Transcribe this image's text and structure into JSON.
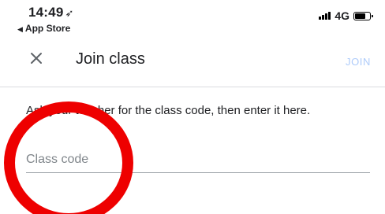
{
  "status_bar": {
    "time": "14:49",
    "location_icon": "location-arrow-icon",
    "back_app": "App Store",
    "network": "4G",
    "signal_icon": "signal-bars-icon",
    "battery_icon": "battery-icon"
  },
  "header": {
    "close_icon": "close-icon",
    "title": "Join class",
    "join_label": "JOIN",
    "join_color": "#aecbfa"
  },
  "main": {
    "instructions": "Ask your teacher for the class code, then enter it here.",
    "class_code": {
      "placeholder": "Class code",
      "value": ""
    }
  },
  "annotation": {
    "shape": "circle",
    "color": "#ee0000"
  }
}
